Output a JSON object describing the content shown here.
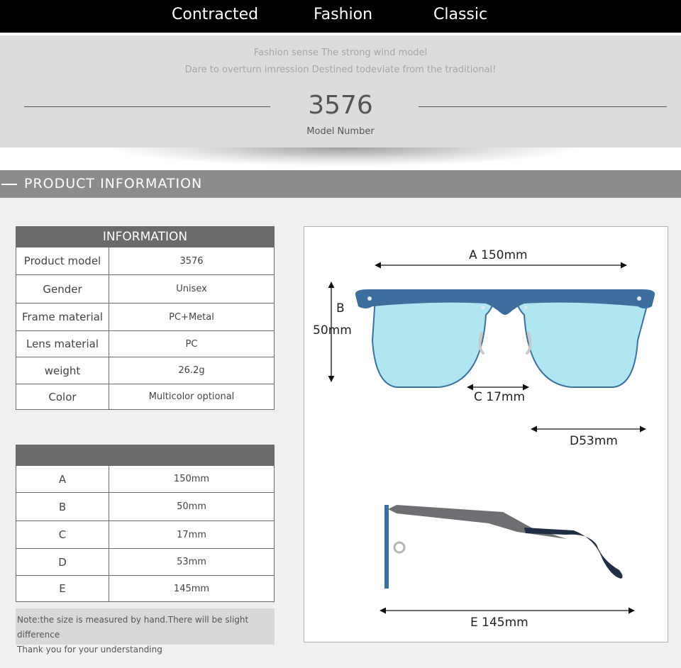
{
  "header": {
    "words": [
      "Contracted",
      "Fashion",
      "Classic"
    ]
  },
  "hero": {
    "tagline_1": "Fashion sense The strong wind model",
    "tagline_2": "Dare to overturn imression Destined todeviate from the traditional!",
    "model_number": "3576",
    "model_caption": "Model Number"
  },
  "section": {
    "title": "PRODUCT INFORMATION"
  },
  "info_table": {
    "header": "INFORMATION",
    "rows": [
      {
        "label": "Product model",
        "value": "3576"
      },
      {
        "label": "Gender",
        "value": "Unisex"
      },
      {
        "label": "Frame material",
        "value": "PC+Metal"
      },
      {
        "label": "Lens material",
        "value": "PC"
      },
      {
        "label": "weight",
        "value": "26.2g"
      },
      {
        "label": "Color",
        "value": "Multicolor optional"
      }
    ]
  },
  "size_table": {
    "header": "",
    "rows": [
      {
        "label": "A",
        "value": "150mm"
      },
      {
        "label": "B",
        "value": "50mm"
      },
      {
        "label": "C",
        "value": "17mm"
      },
      {
        "label": "D",
        "value": "53mm"
      },
      {
        "label": "E",
        "value": "145mm"
      }
    ]
  },
  "note": {
    "line_1": "Note:the size is measured by hand.There will be slight difference",
    "line_2": "Thank you for your understanding"
  },
  "diagram": {
    "dim_a": "A 150mm",
    "dim_b_letter": "B",
    "dim_b_value": "50mm",
    "dim_c": "C 17mm",
    "dim_d": "D53mm",
    "dim_e": "E 145mm",
    "colors": {
      "frame": "#3d6f9e",
      "lens": "#aee6f2",
      "temple": "#1f2e44",
      "arm": "#6d6f73"
    }
  }
}
